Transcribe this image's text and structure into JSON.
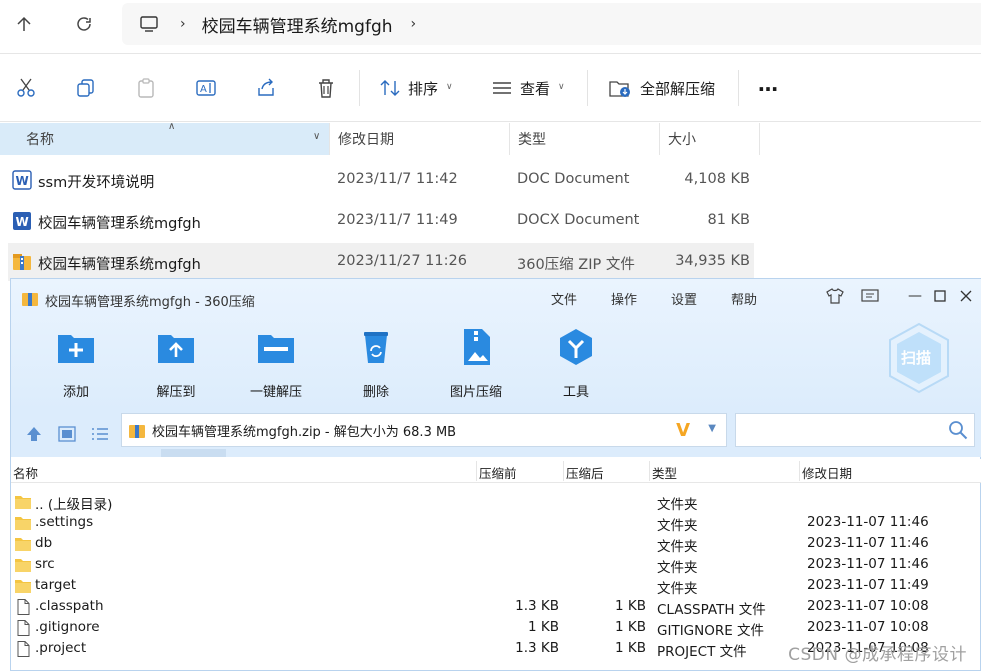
{
  "explorer": {
    "breadcrumb": "校园车辆管理系统mgfgh",
    "toolbar": {
      "sort_label": "排序",
      "view_label": "查看",
      "extract_all_label": "全部解压缩"
    },
    "columns": {
      "name": "名称",
      "date": "修改日期",
      "type": "类型",
      "size": "大小"
    },
    "files": [
      {
        "name": "ssm开发环境说明",
        "date": "2023/11/7 11:42",
        "type": "DOC Document",
        "size": "4,108 KB"
      },
      {
        "name": "校园车辆管理系统mgfgh",
        "date": "2023/11/7 11:49",
        "type": "DOCX Document",
        "size": "81 KB"
      },
      {
        "name": "校园车辆管理系统mgfgh",
        "date": "2023/11/27 11:26",
        "type": "360压缩 ZIP 文件",
        "size": "34,935 KB"
      }
    ]
  },
  "zip_window": {
    "title": "校园车辆管理系统mgfgh - 360压缩",
    "menu": [
      "文件",
      "操作",
      "设置",
      "帮助"
    ],
    "toolbar": [
      "添加",
      "解压到",
      "一键解压",
      "删除",
      "图片压缩",
      "工具"
    ],
    "scan_label": "扫描",
    "path_text": "校园车辆管理系统mgfgh.zip - 解包大小为 68.3 MB",
    "columns": {
      "name": "名称",
      "before": "压缩前",
      "after": "压缩后",
      "type": "类型",
      "date": "修改日期"
    },
    "rows": [
      {
        "name": ".. (上级目录)",
        "before": "",
        "after": "",
        "type": "文件夹",
        "date": "",
        "kind": "folder"
      },
      {
        "name": ".settings",
        "before": "",
        "after": "",
        "type": "文件夹",
        "date": "2023-11-07 11:46",
        "kind": "folder"
      },
      {
        "name": "db",
        "before": "",
        "after": "",
        "type": "文件夹",
        "date": "2023-11-07 11:46",
        "kind": "folder"
      },
      {
        "name": "src",
        "before": "",
        "after": "",
        "type": "文件夹",
        "date": "2023-11-07 11:46",
        "kind": "folder"
      },
      {
        "name": "target",
        "before": "",
        "after": "",
        "type": "文件夹",
        "date": "2023-11-07 11:49",
        "kind": "folder"
      },
      {
        "name": ".classpath",
        "before": "1.3 KB",
        "after": "1 KB",
        "type": "CLASSPATH 文件",
        "date": "2023-11-07 10:08",
        "kind": "file"
      },
      {
        "name": ".gitignore",
        "before": "1 KB",
        "after": "1 KB",
        "type": "GITIGNORE 文件",
        "date": "2023-11-07 10:08",
        "kind": "file"
      },
      {
        "name": ".project",
        "before": "1.3 KB",
        "after": "1 KB",
        "type": "PROJECT 文件",
        "date": "2023-11-07 10:08",
        "kind": "file"
      }
    ]
  },
  "watermark": "CSDN @成承程序设计",
  "colors": {
    "accent_blue": "#2a8ae0",
    "folder_yellow": "#f4c542",
    "header_select": "#d9ebf9"
  }
}
